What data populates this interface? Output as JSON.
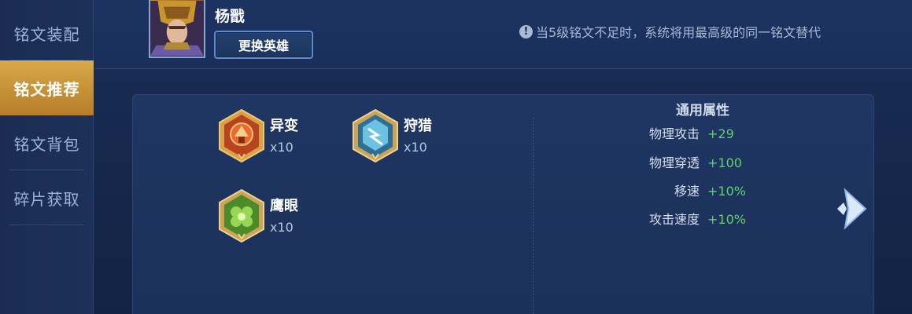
{
  "sidebar": {
    "items": [
      {
        "label": "铭文装配",
        "active": false
      },
      {
        "label": "铭文推荐",
        "active": true
      },
      {
        "label": "铭文背包",
        "active": false
      },
      {
        "label": "碎片获取",
        "active": false
      }
    ]
  },
  "hero": {
    "name": "杨戬",
    "change_label": "更换英雄"
  },
  "notice": {
    "icon": "info-icon",
    "text": "当5级铭文不足时，系统将用最高级的同一铭文替代"
  },
  "runes": [
    {
      "name": "异变",
      "count": "x10",
      "color": "#c8552a"
    },
    {
      "name": "狩猎",
      "count": "x10",
      "color": "#3f8fb8"
    },
    {
      "name": "鹰眼",
      "count": "x10",
      "color": "#6aa63a"
    }
  ],
  "attributes": {
    "title": "通用属性",
    "rows": [
      {
        "label": "物理攻击",
        "value": "+29"
      },
      {
        "label": "物理穿透",
        "value": "+100"
      },
      {
        "label": "移速",
        "value": "+10%"
      },
      {
        "label": "攻击速度",
        "value": "+10%"
      }
    ]
  },
  "colors": {
    "accent_gold": "#c8922f",
    "value_green": "#5fd070"
  }
}
